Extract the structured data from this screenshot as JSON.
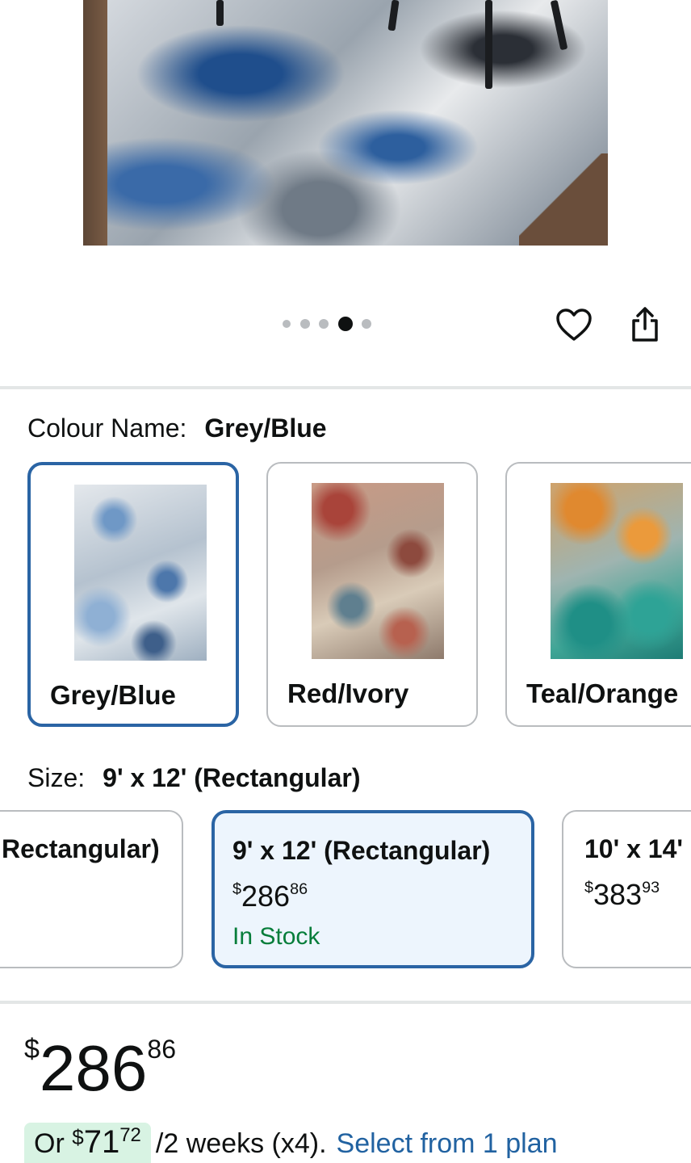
{
  "gallery": {
    "dots_total": 5,
    "active_index": 3
  },
  "icons": {
    "wishlist": "heart-outline-icon",
    "share": "share-icon"
  },
  "colour": {
    "label": "Colour Name:",
    "selected": "Grey/Blue",
    "options": [
      {
        "name": "Grey/Blue",
        "selected": true
      },
      {
        "name": "Red/Ivory",
        "selected": false
      },
      {
        "name": "Teal/Orange",
        "selected": false
      }
    ]
  },
  "size": {
    "label": "Size:",
    "selected": "9' x 12' (Rectangular)",
    "options": [
      {
        "title": "Rectangular)"
      },
      {
        "title": "9' x 12' (Rectangular)",
        "price_currency": "$",
        "price_dollars": "286",
        "price_cents": "86",
        "stock": "In Stock"
      },
      {
        "title": "10' x 14'",
        "price_currency": "$",
        "price_dollars": "383",
        "price_cents": "93"
      }
    ]
  },
  "price": {
    "currency": "$",
    "dollars": "286",
    "cents": "86"
  },
  "installment": {
    "prefix": "Or",
    "currency": "$",
    "dollars": "71",
    "cents": "72",
    "period": "/2 weeks (x4).",
    "link": "Select from 1 plan"
  },
  "colors": {
    "selected_border": "#2a64a4",
    "selected_bg": "#edf5fd",
    "in_stock": "#067d3a",
    "link": "#2162a1",
    "installment_bg": "#d8f3e3"
  }
}
